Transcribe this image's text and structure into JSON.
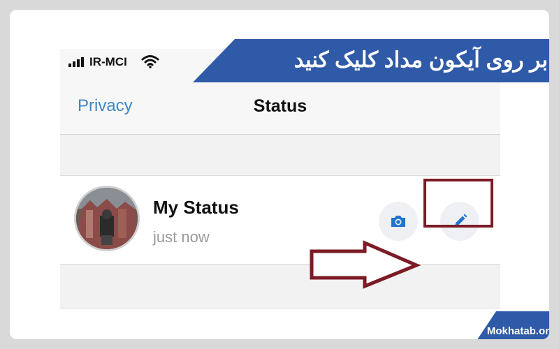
{
  "banner": {
    "text": "بر روی آیکون مداد کلیک کنید"
  },
  "statusbar": {
    "carrier": "IR-MCI"
  },
  "navbar": {
    "back_label": "Privacy",
    "title": "Status"
  },
  "status_row": {
    "title": "My Status",
    "subtitle": "just now"
  },
  "actions": [
    {
      "icon": "camera-icon"
    },
    {
      "icon": "pencil-icon"
    }
  ],
  "footer": {
    "site": "Mokhatab.org"
  },
  "colors": {
    "banner_bg": "#2f5aa8",
    "link_blue": "#3f89c8",
    "icon_blue": "#1f74cf",
    "highlight": "#7c1a25"
  }
}
